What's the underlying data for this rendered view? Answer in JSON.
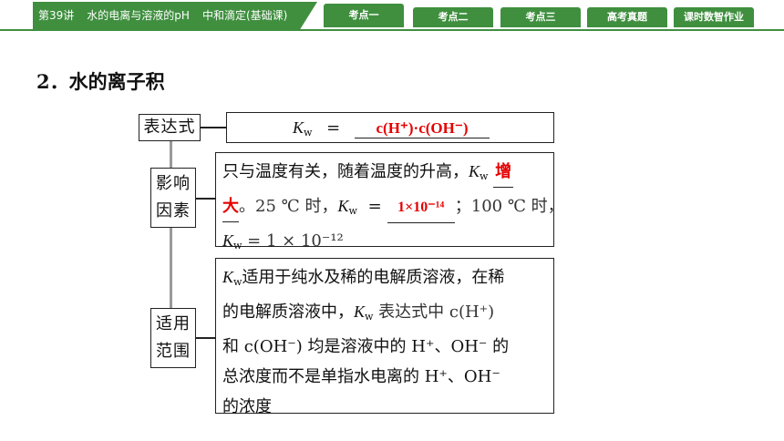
{
  "topbar": {
    "lesson": {
      "number": "第39讲",
      "title": "水的电离与溶液的pH",
      "subtitle": "中和滴定(基础课)"
    },
    "tabs": [
      {
        "label": "考点一",
        "active": true
      },
      {
        "label": "考点二",
        "active": false
      },
      {
        "label": "考点三",
        "active": false
      },
      {
        "label": "高考真题",
        "active": false
      },
      {
        "label": "课时数智作业",
        "active": false
      }
    ],
    "accent_color": "#3f8f3f"
  },
  "heading": "2．水的离子积",
  "diagram": {
    "expression": {
      "label": "表达式",
      "kw_symbol": "K",
      "kw_sub": "w",
      "equals": "=",
      "answer": "c(H⁺)·c(OH⁻)"
    },
    "factors": {
      "label_line1": "影响",
      "label_line2": "因素",
      "line1_text": "只与温度有关，随着温度的升高，",
      "line1_kw": "K",
      "line1_kw_sub": "w",
      "line1_answer": "增",
      "line2_answer": "大",
      "line2_text": "。25 ℃ 时，",
      "line2_kw": "K",
      "line2_kw_sub": "w",
      "line2_equals": "=",
      "line2_answer2": "1×10⁻¹⁴",
      "line2_tail": "；100 ℃ 时，",
      "line3_kw": "K",
      "line3_kw_sub": "w",
      "line3_text": " = 1 × 10⁻¹²"
    },
    "scope": {
      "label_line1": "适用",
      "label_line2": "范围",
      "lines": [
        "适用于纯水及稀的电解质溶液，在稀",
        "的电解质溶液中，",
        "和 c(OH⁻) 均是溶液中的 H⁺、OH⁻ 的",
        "总浓度而不是单指水电离的 H⁺、OH⁻",
        "的浓度"
      ],
      "line1_kw": "K",
      "line1_kw_sub": "w",
      "line2_kw": "K",
      "line2_kw_sub": "w",
      "line2_tail": " 表达式中 c(H⁺)"
    },
    "answer_color": "#e60000"
  }
}
